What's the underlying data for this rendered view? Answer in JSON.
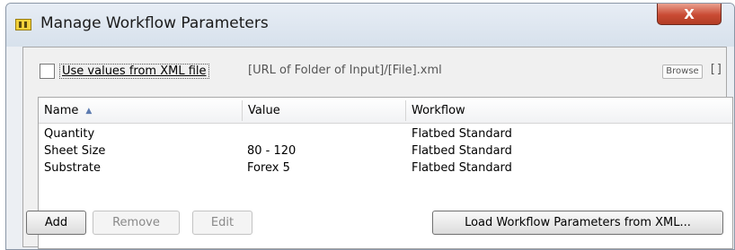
{
  "window": {
    "title": "Manage Workflow Parameters",
    "close_label": "X"
  },
  "xml_source": {
    "checkbox_checked": false,
    "label": "Use values from XML file",
    "path_value": "[URL of Folder of Input]/[File].xml",
    "browse_label": "Browse",
    "extra_label": "[]"
  },
  "table": {
    "columns": {
      "name": "Name",
      "value": "Value",
      "workflow": "Workflow"
    },
    "sort_icon": "▲",
    "rows": [
      {
        "name": "Quantity",
        "value": "",
        "workflow": "Flatbed Standard"
      },
      {
        "name": "Sheet Size",
        "value": "80 - 120",
        "workflow": "Flatbed Standard"
      },
      {
        "name": "Substrate",
        "value": "Forex 5",
        "workflow": "Flatbed Standard"
      }
    ]
  },
  "actions": {
    "add": "Add",
    "remove": "Remove",
    "edit": "Edit",
    "load_xml": "Load Workflow Parameters from XML..."
  }
}
